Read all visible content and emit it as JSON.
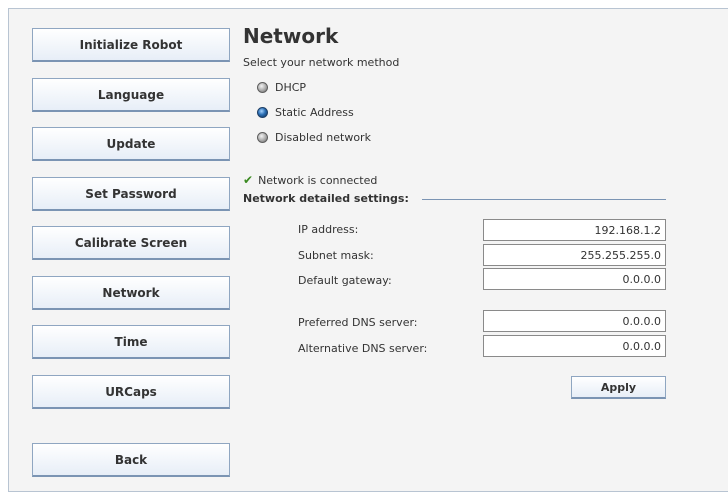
{
  "sidebar": {
    "items": [
      {
        "label": "Initialize Robot"
      },
      {
        "label": "Language"
      },
      {
        "label": "Update"
      },
      {
        "label": "Set Password"
      },
      {
        "label": "Calibrate Screen"
      },
      {
        "label": "Network"
      },
      {
        "label": "Time"
      },
      {
        "label": "URCaps"
      }
    ],
    "back_label": "Back"
  },
  "main": {
    "title": "Network",
    "subtitle": "Select your network method",
    "methods": [
      {
        "label": "DHCP",
        "selected": false
      },
      {
        "label": "Static Address",
        "selected": true
      },
      {
        "label": "Disabled network",
        "selected": false
      }
    ],
    "status_text": "Network is connected",
    "section_title": "Network detailed settings:",
    "fields": {
      "ip_address": {
        "label": "IP address:",
        "value": "192.168.1.2"
      },
      "subnet_mask": {
        "label": "Subnet mask:",
        "value": "255.255.255.0"
      },
      "default_gateway": {
        "label": "Default gateway:",
        "value": "0.0.0.0"
      },
      "preferred_dns": {
        "label": "Preferred DNS server:",
        "value": "0.0.0.0"
      },
      "alternative_dns": {
        "label": "Alternative DNS server:",
        "value": "0.0.0.0"
      }
    },
    "apply_label": "Apply"
  },
  "icons": {
    "status": "check-icon",
    "radio_selected": "radio-selected-icon",
    "radio_unselected": "radio-unselected-icon"
  },
  "colors": {
    "button_border": "#8fa6c1",
    "radio_selected": "#2b6fb5",
    "check": "#3a8a20"
  }
}
